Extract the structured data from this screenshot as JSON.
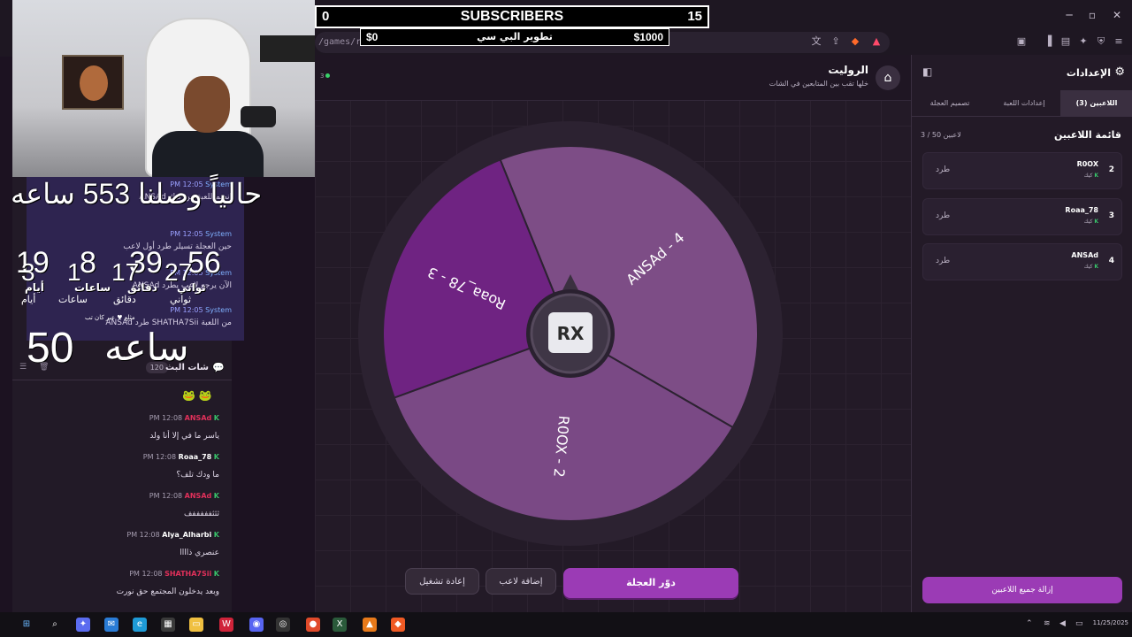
{
  "overlay": {
    "subs_left": "0",
    "subs_title": "SUBSCRIBERS",
    "subs_right": "15",
    "goal_left": "$0",
    "goal_mid": "تطوير البي سي",
    "goal_right": "$1000"
  },
  "browser": {
    "url_fragment": "/games/roulette?kick=r0ox"
  },
  "timer": {
    "caption": "حالياً وصلنا 553 ساعه",
    "days_big": "19",
    "hours_big": "8",
    "minutes_big": "39",
    "seconds_big": "56",
    "days_small": "3",
    "hours_small": "1",
    "minutes_small": "17",
    "seconds_small": "27",
    "label_seconds": "ثواني",
    "label_minutes": "دقائق",
    "label_hours": "ساعات",
    "label_days": "أيام",
    "label_seconds_2": "ثواني",
    "label_minutes_2": "دقائق",
    "label_hours_2": "ساعات",
    "label_days_2": "أيام",
    "hours_total_num": "50",
    "hours_total_label": "ساعه",
    "small_caption": "مثلع ♥ عبر كان تب"
  },
  "system_messages": [
    {
      "sender": "System",
      "time": "PM 12:05",
      "text": "ANSAd انضم للعبة من كيك"
    },
    {
      "sender": "System",
      "time": "PM 12:05",
      "text": "حين العجلة تسيلر طرد أول لاعب"
    },
    {
      "sender": "System",
      "time": "PM 12:05",
      "text": "ANSAd الآن يرجع لاعب يطرد"
    },
    {
      "sender": "System",
      "time": "PM 12:05",
      "text": "ANSAd طرد SHATHA7Sii من اللعبة"
    }
  ],
  "chat": {
    "title": "شات البث",
    "count": "120",
    "emotes": "🐸 🐸",
    "messages": [
      {
        "name": "ANSAd",
        "name_color": "#e0305a",
        "time": "PM 12:08",
        "text": "ياسر ما في إلا أنا ولد"
      },
      {
        "name": "Roaa_78",
        "name_color": "#ffffff",
        "time": "PM 12:08",
        "text": "ما ودك تلف؟"
      },
      {
        "name": "ANSAd",
        "name_color": "#e0305a",
        "time": "PM 12:08",
        "text": "ثثثفففففف"
      },
      {
        "name": "Alya_Alharbi",
        "name_color": "#ffffff",
        "time": "PM 12:08",
        "text": "عنصري ذاااا"
      },
      {
        "name": "SHATHA7Sii",
        "name_color": "#e0305a",
        "time": "PM 12:08",
        "text": "وبعد يدخلون المجتمع حق نورت"
      }
    ]
  },
  "page": {
    "title": "الروليت",
    "subtitle": "خلها تقب بين المتابعين في الشات",
    "online": "3"
  },
  "wheel": {
    "logo": "RX",
    "segments": [
      {
        "label": "ANSAd - 4",
        "color": "#7d4d86"
      },
      {
        "label": "R0OX - 2",
        "color": "#7a4985"
      },
      {
        "label": "Roaa_78 - 3",
        "color": "#6f2382"
      }
    ]
  },
  "buttons": {
    "spin": "دوّر العجلة",
    "add_player": "إضافة لاعب",
    "restart": "إعادة تشغيل"
  },
  "settings": {
    "title": "الإعدادات",
    "tabs": [
      "اللاعبين (3)",
      "إعدادات اللعبة",
      "تصميم العجلة"
    ],
    "players_heading": "قائمة اللاعبين",
    "players_count": "3 / 50 لاعبين",
    "players": [
      {
        "num": "2",
        "name": "R0OX",
        "platform": "كيك",
        "kick_label": "طرد"
      },
      {
        "num": "3",
        "name": "Roaa_78",
        "platform": "كيك",
        "kick_label": "طرد"
      },
      {
        "num": "4",
        "name": "ANSAd",
        "platform": "كيك",
        "kick_label": "طرد"
      }
    ],
    "remove_all": "إزالة جميع اللاعبين"
  },
  "taskbar": {
    "clock": "11/25/2025"
  }
}
